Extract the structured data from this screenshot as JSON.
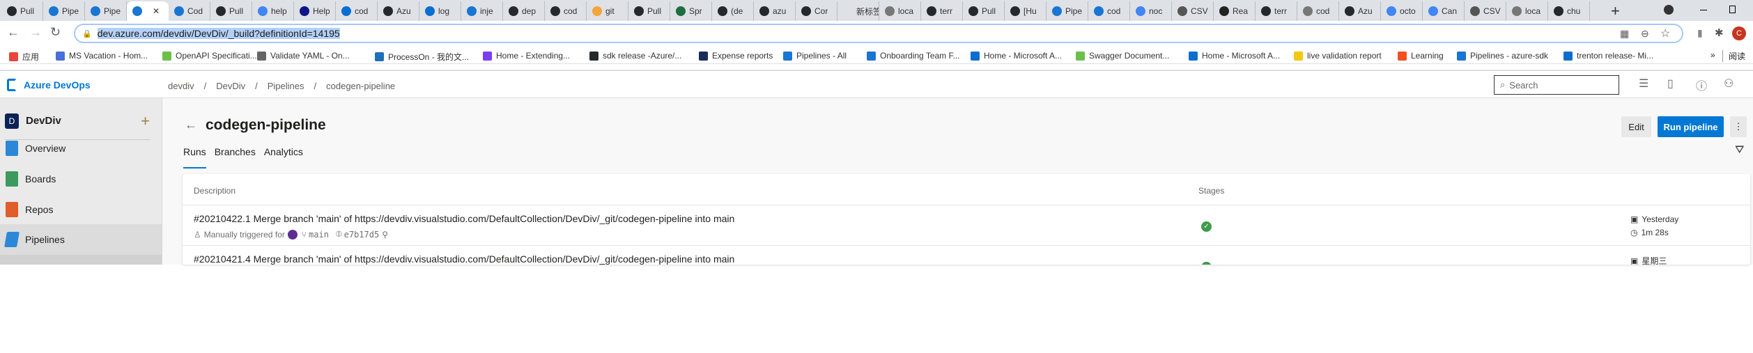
{
  "browser": {
    "tabs": [
      {
        "label": "Pull",
        "icon": "github"
      },
      {
        "label": "Pipe",
        "icon": "azure-pipelines"
      },
      {
        "label": "Pipe",
        "icon": "azure-pipelines"
      },
      {
        "label": "",
        "icon": "azure-pipelines",
        "active": true
      },
      {
        "label": "Cod",
        "icon": "azure-pipelines"
      },
      {
        "label": "Pull",
        "icon": "github"
      },
      {
        "label": "help",
        "icon": "google"
      },
      {
        "label": "Help",
        "icon": "helm"
      },
      {
        "label": "cod",
        "icon": "azure"
      },
      {
        "label": "Azu",
        "icon": "github"
      },
      {
        "label": "log",
        "icon": "azure"
      },
      {
        "label": "inje",
        "icon": "azure-pipelines"
      },
      {
        "label": "dep",
        "icon": "github"
      },
      {
        "label": "cod",
        "icon": "github"
      },
      {
        "label": "git",
        "icon": "git"
      },
      {
        "label": "Pull",
        "icon": "github"
      },
      {
        "label": "Spr",
        "icon": "excel"
      },
      {
        "label": "(de",
        "icon": "github"
      },
      {
        "label": "azu",
        "icon": "github"
      },
      {
        "label": "Cor",
        "icon": "github"
      },
      {
        "label": "新标签",
        "icon": "none"
      },
      {
        "label": "loca",
        "icon": "globe"
      },
      {
        "label": "terr",
        "icon": "github"
      },
      {
        "label": "Pull",
        "icon": "github"
      },
      {
        "label": "[Hu",
        "icon": "github-error"
      },
      {
        "label": "Pipe",
        "icon": "azure-pipelines"
      },
      {
        "label": "cod",
        "icon": "azure-pipelines"
      },
      {
        "label": "noc",
        "icon": "google"
      },
      {
        "label": "CSV",
        "icon": "csv"
      },
      {
        "label": "Rea",
        "icon": "sa"
      },
      {
        "label": "terr",
        "icon": "github"
      },
      {
        "label": "cod",
        "icon": "globe"
      },
      {
        "label": "Azu",
        "icon": "github"
      },
      {
        "label": "octo",
        "icon": "google"
      },
      {
        "label": "Can",
        "icon": "google"
      },
      {
        "label": "CSV",
        "icon": "csv"
      },
      {
        "label": "loca",
        "icon": "globe"
      },
      {
        "label": "chu",
        "icon": "github"
      }
    ],
    "new_tab": "+",
    "url": "dev.azure.com/devdiv/DevDiv/_build?definitionId=14195",
    "bookmarks": [
      {
        "label": "应用",
        "color": "#e8453c"
      },
      {
        "label": "MS Vacation - Hom...",
        "color": "#4a6fd8"
      },
      {
        "label": "OpenAPI Specificati...",
        "color": "#6cc04a"
      },
      {
        "label": "Validate YAML - On...",
        "color": "#666666"
      },
      {
        "label": "ProcessOn - 我的文...",
        "color": "#1e6fb8"
      },
      {
        "label": "Home - Extending...",
        "color": "#7a3ff2"
      },
      {
        "label": "sdk release -Azure/...",
        "color": "#24292e"
      },
      {
        "label": "Expense reports",
        "color": "#1a2b5c"
      },
      {
        "label": "Pipelines - All",
        "color": "#1976d2"
      },
      {
        "label": "Onboarding Team F...",
        "color": "#1976d2"
      },
      {
        "label": "Home - Microsoft A...",
        "color": "#0a6ed1"
      },
      {
        "label": "Swagger Document...",
        "color": "#6cc04a"
      },
      {
        "label": "Home - Microsoft A...",
        "color": "#0a6ed1"
      },
      {
        "label": "live validation report",
        "color": "#f2c811"
      },
      {
        "label": "Learning",
        "color": "#f25022"
      },
      {
        "label": "Pipelines - azure-sdk",
        "color": "#1976d2"
      },
      {
        "label": "trenton release- Mi...",
        "color": "#0a6ed1"
      }
    ],
    "bookmarks_overflow": "»",
    "reading_list": "阅读",
    "avatar_letter": "C"
  },
  "app": {
    "brand": "Azure DevOps",
    "breadcrumb": [
      "devdiv",
      "DevDiv",
      "Pipelines",
      "codegen-pipeline"
    ],
    "breadcrumb_sep": "/",
    "search_placeholder": "Search",
    "accent": "#0078d4"
  },
  "sidebar": {
    "project": "DevDiv",
    "project_initial": "D",
    "add": "+",
    "items": [
      {
        "label": "Overview",
        "color": "#2b88d8"
      },
      {
        "label": "Boards",
        "color": "#3c9a5f"
      },
      {
        "label": "Repos",
        "color": "#e15d2b"
      },
      {
        "label": "Pipelines",
        "color": "#2b88d8",
        "selected": true
      }
    ]
  },
  "page": {
    "title": "codegen-pipeline",
    "tabs": [
      {
        "label": "Runs",
        "active": true
      },
      {
        "label": "Branches"
      },
      {
        "label": "Analytics"
      }
    ],
    "edit": "Edit",
    "run": "Run pipeline",
    "table": {
      "headers": {
        "description": "Description",
        "stages": "Stages"
      },
      "rows": [
        {
          "title": "#20210422.1 Merge branch 'main' of https://devdiv.visualstudio.com/DefaultCollection/DevDiv/_git/codegen-pipeline into main",
          "trigger": "Manually triggered for",
          "branch": "main",
          "commit": "e7b17d5",
          "status": "succeeded",
          "when": "Yesterday",
          "duration": "1m 28s"
        },
        {
          "title": "#20210421.4 Merge branch 'main' of https://devdiv.visualstudio.com/DefaultCollection/DevDiv/_git/codegen-pipeline into main",
          "status": "succeeded",
          "when": "星期三"
        }
      ]
    }
  }
}
